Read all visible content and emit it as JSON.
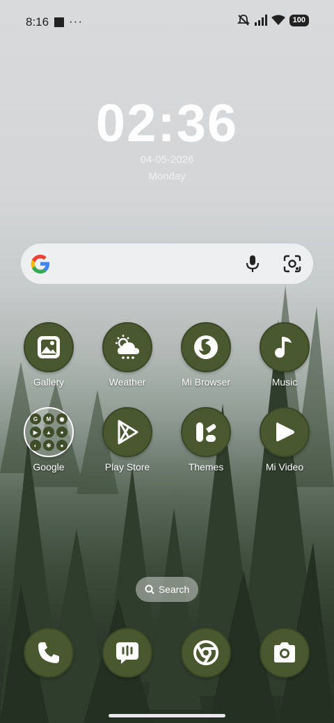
{
  "status_bar": {
    "time": "8:16",
    "dots": "···",
    "battery": "100"
  },
  "clock": {
    "time": "02:36",
    "date": "04-05-2026",
    "day": "Monday"
  },
  "apps_row1": [
    {
      "label": "Gallery",
      "icon": "gallery-icon"
    },
    {
      "label": "Weather",
      "icon": "weather-icon"
    },
    {
      "label": "Mi Browser",
      "icon": "browser-icon"
    },
    {
      "label": "Music",
      "icon": "music-icon"
    }
  ],
  "apps_row2": [
    {
      "label": "Google",
      "icon": "google-folder"
    },
    {
      "label": "Play Store",
      "icon": "play-store-icon"
    },
    {
      "label": "Themes",
      "icon": "themes-icon"
    },
    {
      "label": "Mi Video",
      "icon": "video-icon"
    }
  ],
  "folder_items": [
    "G",
    "M",
    "◉",
    "▶",
    "▲",
    "●",
    "◐",
    "✻",
    "●"
  ],
  "search_pill": {
    "label": "Search"
  },
  "dock": [
    {
      "icon": "phone-icon"
    },
    {
      "icon": "messages-icon"
    },
    {
      "icon": "chrome-icon"
    },
    {
      "icon": "camera-icon"
    }
  ],
  "colors": {
    "app_bg": "#49582f",
    "google_blue": "#4285F4",
    "google_red": "#EA4335",
    "google_yellow": "#FBBC05",
    "google_green": "#34A853"
  }
}
